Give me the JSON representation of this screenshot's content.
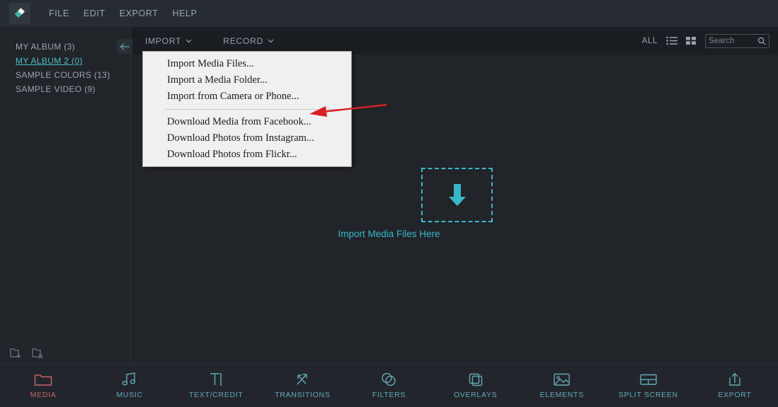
{
  "app": {
    "logo_icon": "filmora-diamond-logo",
    "menubar": [
      {
        "label": "FILE",
        "name": "menu-file"
      },
      {
        "label": "EDIT",
        "name": "menu-edit"
      },
      {
        "label": "EXPORT",
        "name": "menu-export"
      },
      {
        "label": "HELP",
        "name": "menu-help"
      }
    ]
  },
  "sidebar": {
    "collapse_icon": "arrow-left-icon",
    "albums": [
      {
        "label": "MY ALBUM (3)",
        "active": false
      },
      {
        "label": "MY ALBUM 2 (0)",
        "active": true
      },
      {
        "label": "SAMPLE COLORS (13)",
        "active": false
      },
      {
        "label": "SAMPLE VIDEO (9)",
        "active": false
      }
    ],
    "footer": {
      "add_folder_icon": "folder-add-icon",
      "delete_folder_icon": "folder-delete-icon"
    }
  },
  "subtoolbar": {
    "import_label": "IMPORT",
    "import_chevron_icon": "chevron-down-icon",
    "record_label": "RECORD",
    "record_chevron_icon": "chevron-down-icon",
    "all_label": "ALL",
    "list_view_icon": "list-view-icon",
    "grid_view_icon": "grid-view-icon",
    "search": {
      "value": "",
      "placeholder": "Search",
      "icon": "search-icon"
    }
  },
  "import_menu": {
    "open": true,
    "items": [
      {
        "label": "Import Media Files...",
        "name": "menu-import-media-files"
      },
      {
        "label": "Import a Media Folder...",
        "name": "menu-import-media-folder"
      },
      {
        "label": "Import from Camera or Phone...",
        "name": "menu-import-camera-phone"
      },
      {
        "separator": true
      },
      {
        "label": "Download Media from Facebook...",
        "name": "menu-download-facebook"
      },
      {
        "label": "Download Photos from Instagram...",
        "name": "menu-download-instagram"
      },
      {
        "label": "Download Photos from Flickr...",
        "name": "menu-download-flickr"
      }
    ]
  },
  "dropzone": {
    "icon": "download-arrow-icon",
    "label": "Import Media Files Here"
  },
  "bottom_toolbar": {
    "items": [
      {
        "label": "MEDIA",
        "icon": "folder-icon",
        "active": true
      },
      {
        "label": "MUSIC",
        "icon": "music-note-icon",
        "active": false
      },
      {
        "label": "TEXT/CREDIT",
        "icon": "text-cursor-icon",
        "active": false
      },
      {
        "label": "TRANSITIONS",
        "icon": "transition-arrows-icon",
        "active": false
      },
      {
        "label": "FILTERS",
        "icon": "overlapping-circles-icon",
        "active": false
      },
      {
        "label": "OVERLAYS",
        "icon": "overlapping-squares-icon",
        "active": false
      },
      {
        "label": "ELEMENTS",
        "icon": "image-mountain-icon",
        "active": false
      },
      {
        "label": "SPLIT SCREEN",
        "icon": "split-panel-icon",
        "active": false
      },
      {
        "label": "EXPORT",
        "icon": "upload-box-icon",
        "active": false
      }
    ]
  },
  "annotation": {
    "arrow_icon": "red-pointer-arrow",
    "color": "#d81f26"
  },
  "colors": {
    "accent_teal": "#3ab6c9",
    "accent_red": "#c1636a",
    "bg_main": "#212429",
    "bg_topbar": "#272c33",
    "bg_subbar": "#1a1d22",
    "bg_bottombar": "#22262c",
    "menu_bg": "#f0f0f0"
  }
}
